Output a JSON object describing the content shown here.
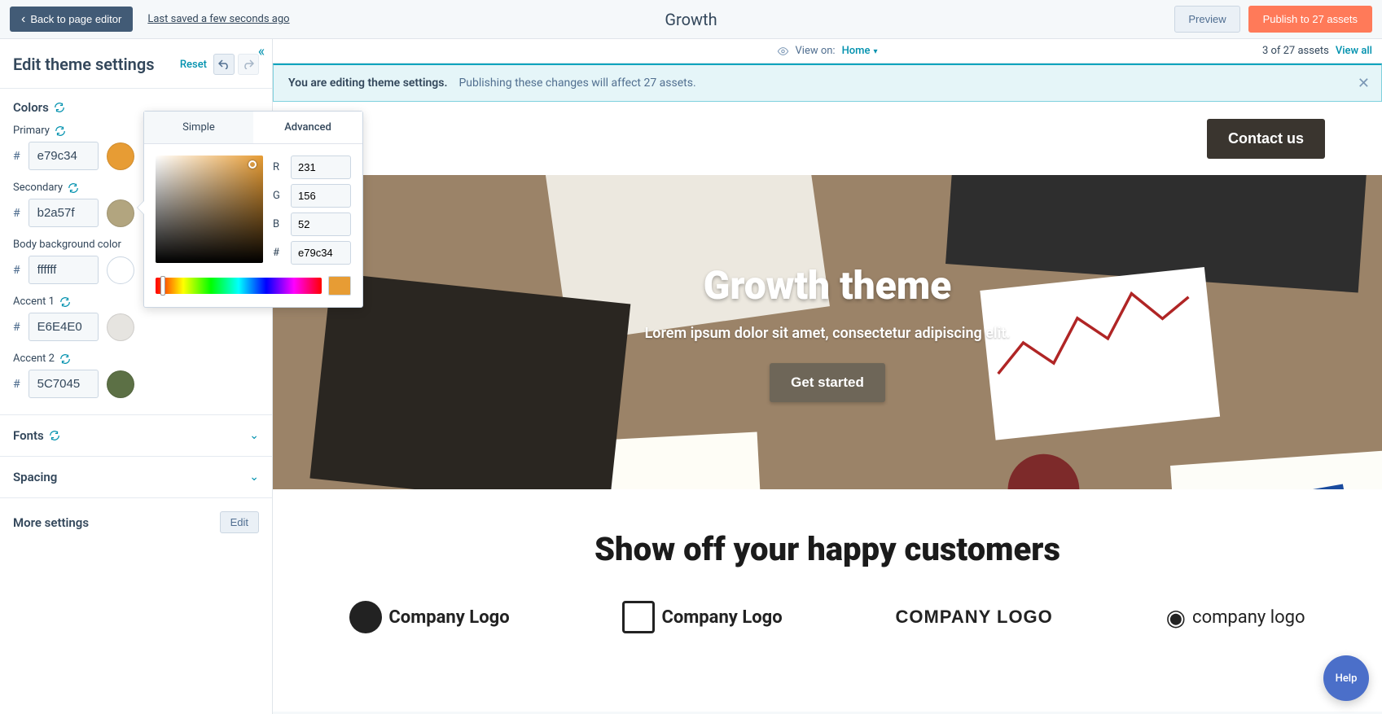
{
  "topbar": {
    "back": "Back to page editor",
    "last_saved": "Last saved a few seconds ago",
    "title": "Growth",
    "preview": "Preview",
    "publish": "Publish to 27 assets"
  },
  "secbar": {
    "view_on_label": "View on:",
    "view_on_value": "Home",
    "asset_count": "3 of 27 assets",
    "view_all": "View all"
  },
  "banner": {
    "bold": "You are editing theme settings.",
    "text": "Publishing these changes will affect 27 assets."
  },
  "sidebar": {
    "title": "Edit theme settings",
    "reset": "Reset",
    "colors": {
      "section_label": "Colors",
      "primary": {
        "label": "Primary",
        "hex": "e79c34",
        "swatch": "#e79c34"
      },
      "secondary": {
        "label": "Secondary",
        "hex": "b2a57f",
        "swatch": "#b2a57f"
      },
      "body_bg": {
        "label": "Body background color",
        "hex": "ffffff",
        "swatch": "#ffffff"
      },
      "accent1": {
        "label": "Accent 1",
        "hex": "E6E4E0",
        "swatch": "#E6E4E0"
      },
      "accent2": {
        "label": "Accent 2",
        "hex": "5C7045",
        "swatch": "#5C7045"
      }
    },
    "fonts_label": "Fonts",
    "spacing_label": "Spacing",
    "more_settings_label": "More settings",
    "edit_label": "Edit"
  },
  "picker": {
    "tab_simple": "Simple",
    "tab_advanced": "Advanced",
    "r_label": "R",
    "r_value": "231",
    "g_label": "G",
    "g_value": "156",
    "b_label": "B",
    "b_value": "52",
    "hash_label": "#",
    "hex_value": "e79c34",
    "preview_color": "#e79c34"
  },
  "preview": {
    "contact": "Contact us",
    "hero_title": "Growth theme",
    "hero_sub": "Lorem ipsum dolor sit amet, consectetur adipiscing elit.",
    "get_started": "Get started",
    "customers_title": "Show off your happy customers",
    "logos": [
      "Company Logo",
      "Company Logo",
      "COMPANY  LOGO",
      "company logo"
    ]
  },
  "help": {
    "label": "Help"
  }
}
